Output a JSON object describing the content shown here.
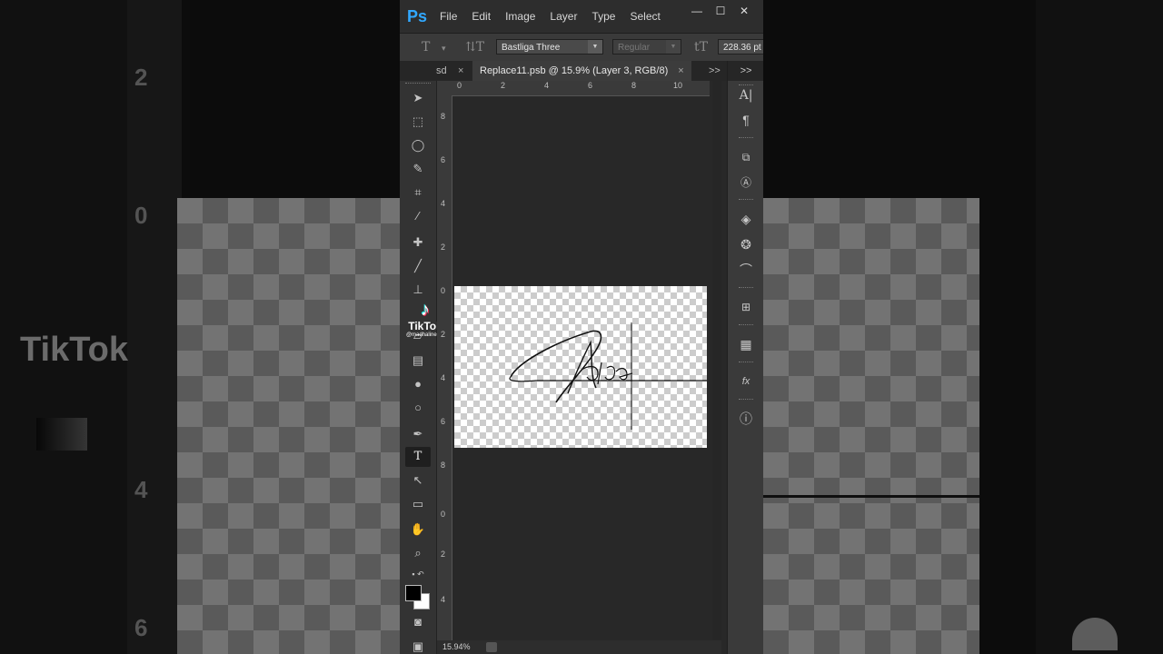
{
  "app": {
    "logo": "Ps",
    "menus": [
      "File",
      "Edit",
      "Image",
      "Layer",
      "Type",
      "Select"
    ]
  },
  "window_controls": {
    "minimize": "—",
    "maximize": "☐",
    "close": "✕"
  },
  "options_bar": {
    "font_family": "Bastliga Three",
    "font_style": "Regular",
    "font_size": "228.36 pt"
  },
  "tabs": {
    "prev_tab_label": "sd",
    "active_tab_label": "Replace11.psb @ 15.9% (Layer 3, RGB/8)",
    "close_glyph": "×",
    "overflow_glyph": ">>"
  },
  "rulers": {
    "horizontal": [
      "0",
      "2",
      "4",
      "6",
      "8",
      "10"
    ],
    "vertical": [
      "8",
      "6",
      "4",
      "2",
      "0",
      "2",
      "4",
      "6",
      "8",
      "0",
      "2",
      "4"
    ]
  },
  "status": {
    "zoom": "15.94%"
  },
  "watermark": {
    "brand": "TikTok",
    "handle": "@madhalinee..."
  },
  "dock_top_glyph": ">>",
  "background": {
    "ruler_numbers": [
      "2",
      "0",
      "4",
      "6"
    ]
  },
  "icons": [
    "move-tool-icon",
    "marquee-tool-icon",
    "lasso-tool-icon",
    "quick-selection-icon",
    "crop-tool-icon",
    "eyedropper-icon",
    "healing-brush-icon",
    "brush-icon",
    "clone-stamp-icon",
    "eraser-icon",
    "gradient-icon",
    "blur-icon",
    "dodge-icon",
    "pen-tool-icon",
    "type-tool-icon",
    "path-selection-icon",
    "rectangle-tool-icon",
    "hand-tool-icon",
    "zoom-tool-icon",
    "quick-mask-icon",
    "screen-mode-icon"
  ],
  "colors": {
    "ps_blue": "#31a8ff",
    "foreground": "#000000",
    "background": "#ffffff"
  }
}
